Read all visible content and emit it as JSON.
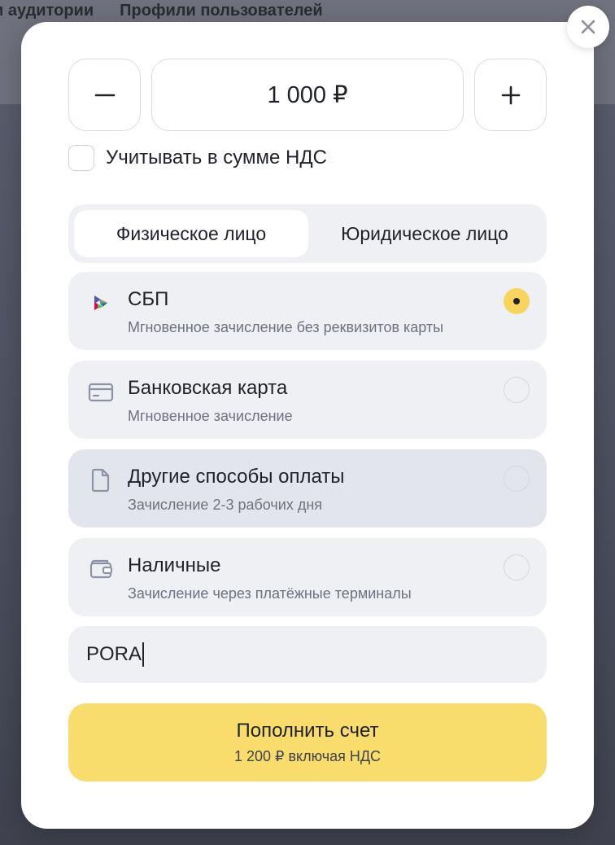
{
  "background": {
    "tabs": [
      "и аудитории",
      "Профили пользователей"
    ]
  },
  "modal": {
    "close_icon": "close-icon",
    "amount": {
      "value": "1 000 ₽",
      "minus_icon": "minus-icon",
      "plus_icon": "plus-icon"
    },
    "vat_checkbox": {
      "label": "Учитывать в сумме НДС",
      "checked": false
    },
    "payer_type": {
      "options": [
        "Физическое лицо",
        "Юридическое лицо"
      ],
      "selected": "Физическое лицо"
    },
    "payment_methods": [
      {
        "icon": "sbp-icon",
        "title": "СБП",
        "subtitle": "Мгновенное зачисление без реквизитов карты",
        "selected": true
      },
      {
        "icon": "card-icon",
        "title": "Банковская карта",
        "subtitle": "Мгновенное зачисление",
        "selected": false
      },
      {
        "icon": "document-icon",
        "title": "Другие способы оплаты",
        "subtitle": "Зачисление 2-3 рабочих дня",
        "selected": false
      },
      {
        "icon": "wallet-icon",
        "title": "Наличные",
        "subtitle": "Зачисление через платёжные терминалы",
        "selected": false
      }
    ],
    "promo_code": {
      "value": "PORA"
    },
    "submit": {
      "label": "Пополнить счет",
      "sublabel": "1 200 ₽ включая НДС"
    },
    "colors": {
      "accent": "#f8dc6c",
      "radio_checked": "#f7d55c",
      "option_bg": "#eff0f4"
    }
  }
}
